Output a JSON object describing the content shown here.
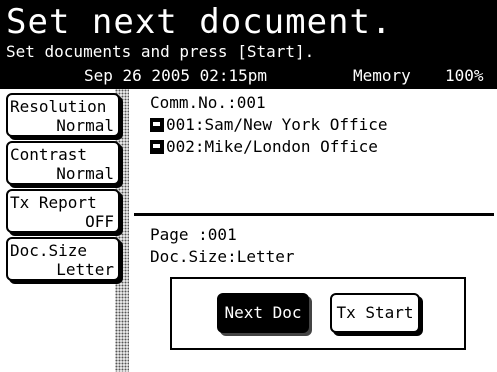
{
  "header": {
    "title": "Set next document.",
    "subtitle": "Set documents and press [Start].",
    "datetime": "Sep 26 2005 02:15pm",
    "mode": "Memory",
    "memory_percent": "100%"
  },
  "sidebar": {
    "items": [
      {
        "label": "Resolution",
        "value": "Normal"
      },
      {
        "label": "Contrast",
        "value": "Normal"
      },
      {
        "label": "Tx Report",
        "value": "OFF"
      },
      {
        "label": "Doc.Size",
        "value": "Letter"
      }
    ]
  },
  "comm": {
    "number": "Comm.No.:001",
    "recipients": [
      "001:Sam/New York Office",
      "002:Mike/London Office"
    ]
  },
  "page_info": {
    "page": "Page :001",
    "doc_size": "Doc.Size:Letter"
  },
  "actions": {
    "next_doc": "Next Doc",
    "tx_start": "Tx Start"
  }
}
